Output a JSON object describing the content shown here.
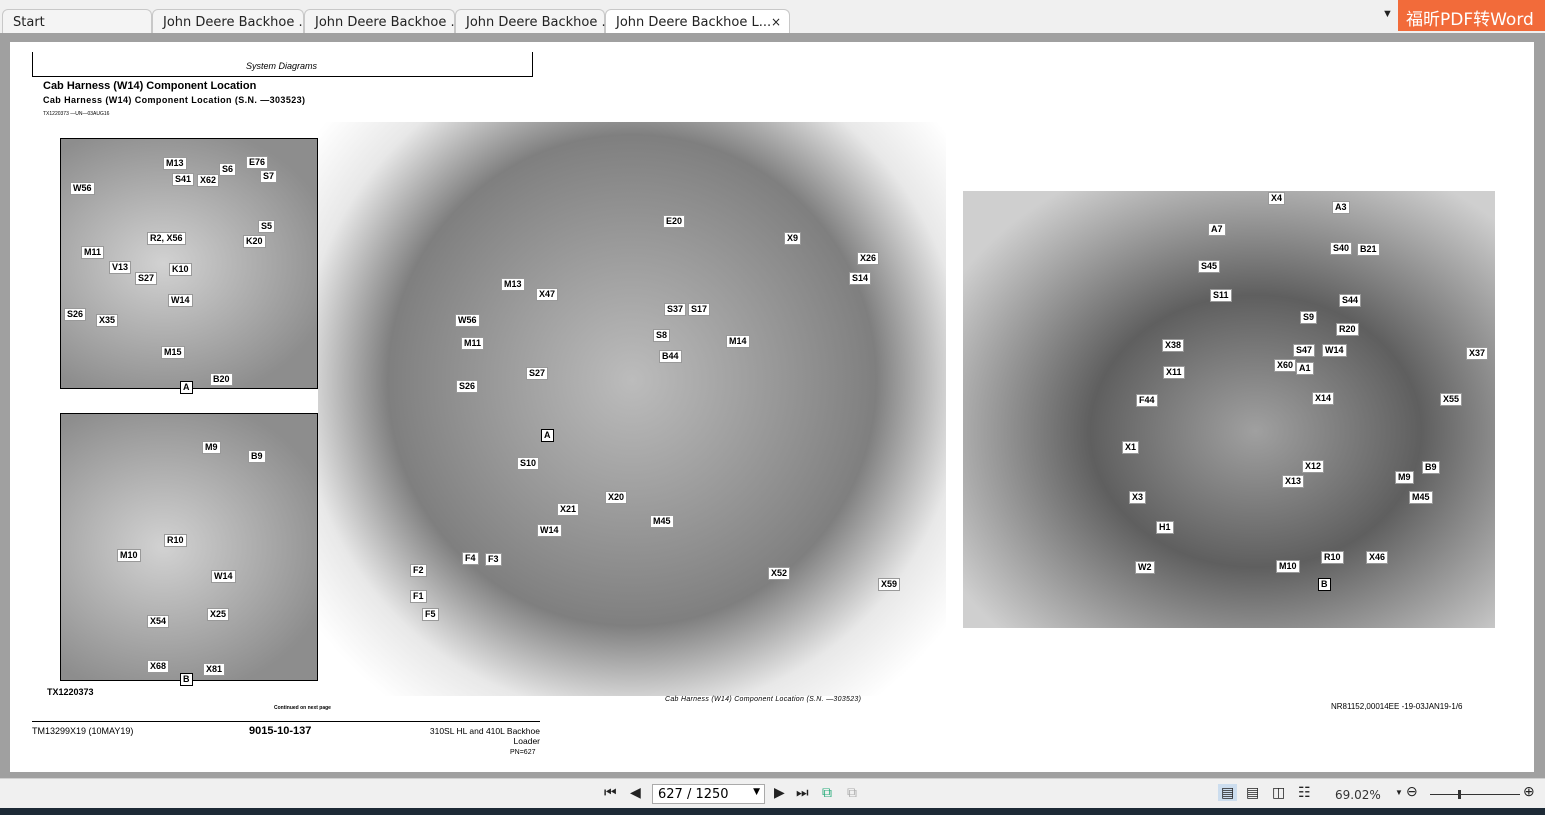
{
  "tabs": [
    {
      "label": "Start"
    },
    {
      "label": "John Deere Backhoe ..."
    },
    {
      "label": "John Deere Backhoe ..."
    },
    {
      "label": "John Deere Backhoe ..."
    },
    {
      "label": "John Deere Backhoe L...",
      "active": true,
      "close": "×"
    }
  ],
  "convert_button": "福昕PDF转Word",
  "doc": {
    "section": "System Diagrams",
    "title": "Cab Harness (W14) Component Location",
    "subtitle": "Cab Harness (W14) Component Location (S.N. —303523)",
    "image_ref": "TX1220373 —UN—03AUG16",
    "figure_id": "TX1220373",
    "continued": "Continued on next page",
    "caption": "Cab Harness (W14) Component Location (S.N. —303523)",
    "ref_code": "NR81152,00014EE -19-03JAN19-1/6",
    "footer_left": "TM13299X19 (10MAY19)",
    "footer_center": "9015-10-137",
    "footer_right": "310SL HL and 410L Backhoe Loader",
    "footer_pn": "PN=627"
  },
  "labels": {
    "insetA": [
      "M13",
      "S41",
      "X62",
      "S6",
      "E76",
      "S7",
      "W56",
      "S5",
      "R2, X56",
      "K20",
      "M11",
      "V13",
      "S27",
      "K10",
      "W14",
      "S26",
      "X35",
      "M15",
      "B20",
      "A"
    ],
    "insetB": [
      "M9",
      "B9",
      "R10",
      "M10",
      "W14",
      "X25",
      "X54",
      "X68",
      "X81",
      "B"
    ],
    "main": [
      "E20",
      "X9",
      "X26",
      "S14",
      "M13",
      "X47",
      "S37",
      "S17",
      "W56",
      "S8",
      "M14",
      "M11",
      "B44",
      "S27",
      "S26",
      "A",
      "S10",
      "X20",
      "X21",
      "M45",
      "W14",
      "F4",
      "F3",
      "F2",
      "F1",
      "F5",
      "X52",
      "X59"
    ],
    "right": [
      "X4",
      "A3",
      "A7",
      "S40",
      "B21",
      "S45",
      "S11",
      "S44",
      "S9",
      "R20",
      "X38",
      "S47",
      "W14",
      "X37",
      "X11",
      "X60",
      "A1",
      "X55",
      "F44",
      "X14",
      "X1",
      "X12",
      "B9",
      "X13",
      "M9",
      "M45",
      "X3",
      "H1",
      "R10",
      "X46",
      "M10",
      "W2",
      "B"
    ]
  },
  "toolbar": {
    "page_value": "627 / 1250",
    "zoom": "69.02%"
  }
}
